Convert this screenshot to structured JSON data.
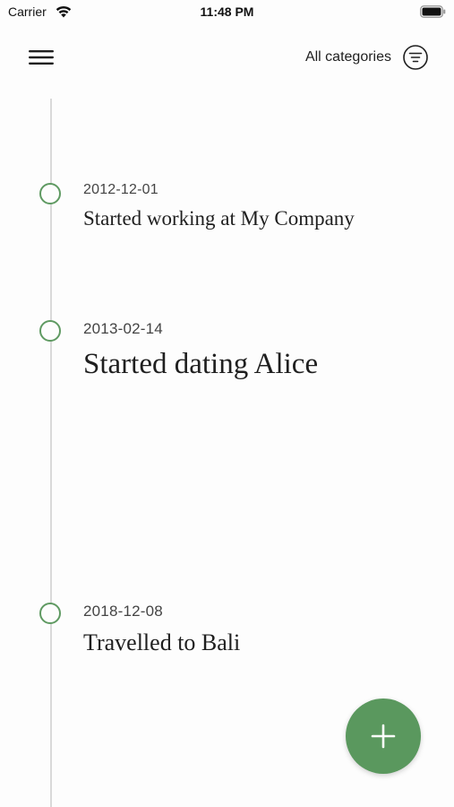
{
  "status_bar": {
    "carrier": "Carrier",
    "time": "11:48 PM",
    "icons": [
      "wifi-icon",
      "battery-icon"
    ]
  },
  "top_bar": {
    "menu_icon": "hamburger-menu-icon",
    "filter_label": "All categories",
    "filter_icon": "filter-icon"
  },
  "events": [
    {
      "date": "2012-12-01",
      "title": "Started working at My Company"
    },
    {
      "date": "2013-02-14",
      "title": "Started dating Alice"
    },
    {
      "date": "2018-12-08",
      "title": "Travelled to Bali"
    }
  ],
  "fab": {
    "icon": "plus-icon"
  },
  "colors": {
    "accent": "#5a985e",
    "timeline_line": "#d9d9d9",
    "background": "#fdfdfd",
    "text": "#1f1f1f"
  }
}
